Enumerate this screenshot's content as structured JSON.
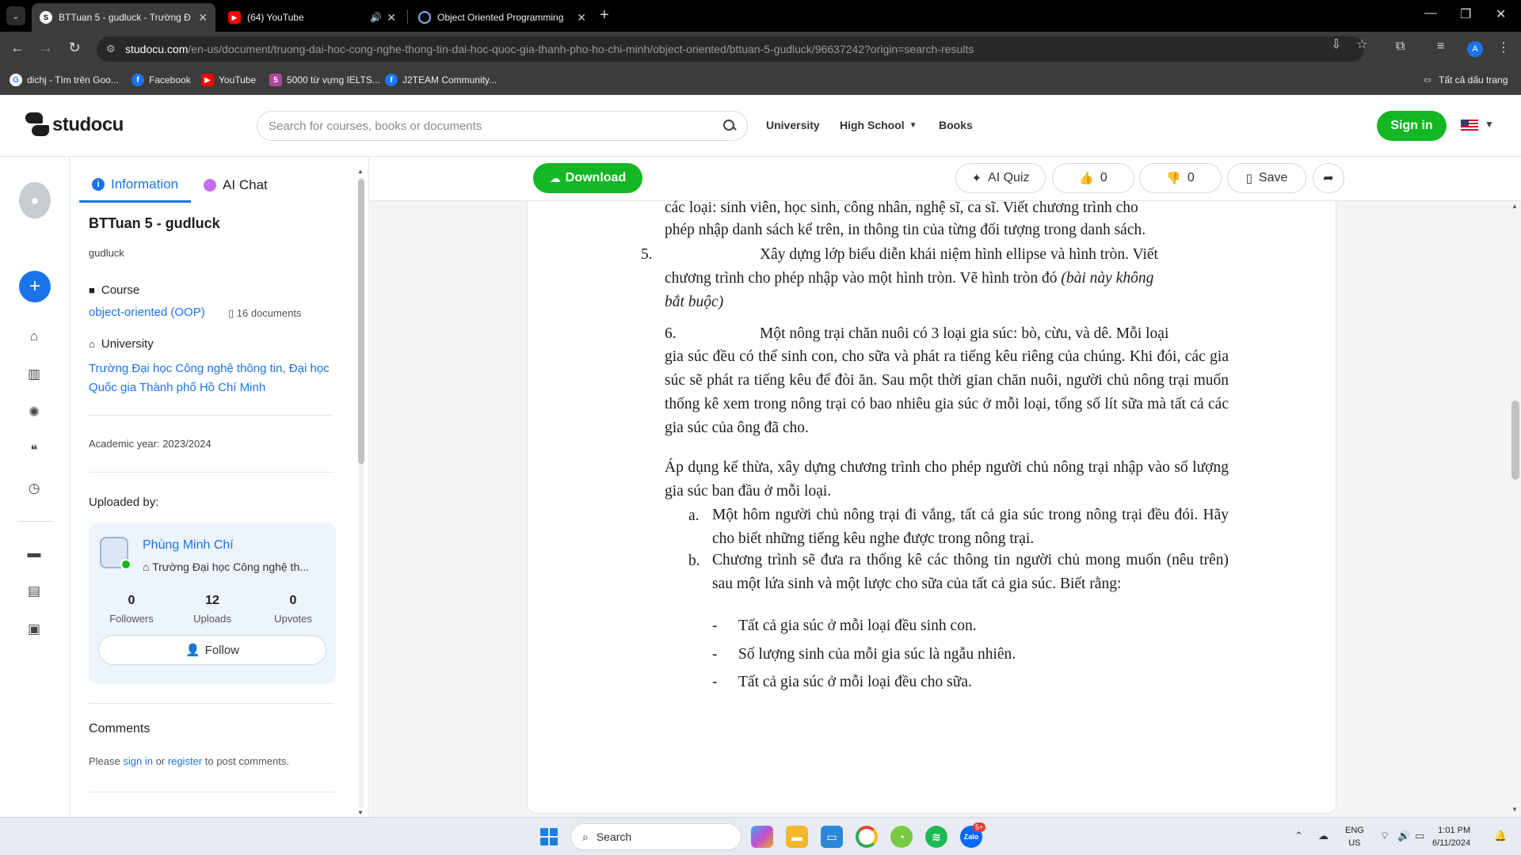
{
  "browser": {
    "tabs": [
      {
        "title": "BTTuan 5 - gudluck - Trường Đ",
        "active": true
      },
      {
        "title": "(64) YouTube",
        "active": false,
        "audio": true
      },
      {
        "title": "Object Oriented Programming",
        "active": false
      }
    ],
    "url_host": "studocu.com",
    "url_path": "/en-us/document/truong-dai-hoc-cong-nghe-thong-tin-dai-hoc-quoc-gia-thanh-pho-ho-chi-minh/object-oriented/bttuan-5-gudluck/96637242?origin=search-results",
    "profile_initial": "A",
    "bookmarks": [
      {
        "label": "dichj - Tìm trên Goo..."
      },
      {
        "label": "Facebook"
      },
      {
        "label": "YouTube"
      },
      {
        "label": "5000 từ vựng IELTS..."
      },
      {
        "label": "J2TEAM Community..."
      }
    ],
    "all_bookmarks": "Tất cả dấu trang"
  },
  "header": {
    "logo": "studocu",
    "search_placeholder": "Search for courses, books or documents",
    "nav": {
      "university": "University",
      "high_school": "High School",
      "books": "Books"
    },
    "signin": "Sign in"
  },
  "sidebar": {
    "tabs": {
      "information": "Information",
      "ai_chat": "AI Chat"
    },
    "doc_title": "BTTuan 5 - gudluck",
    "doc_author": "gudluck",
    "course_label": "Course",
    "course_name": "object-oriented (OOP)",
    "course_docs": "16 documents",
    "university_label": "University",
    "university_name": "Trường Đại học Công nghệ thông tin, Đại học Quốc gia Thành phố Hồ Chí Minh",
    "academic_year": "Academic year: 2023/2024",
    "uploaded_by": "Uploaded by:",
    "uploader": {
      "name": "Phùng Minh Chí",
      "university": "Trường Đại học Công nghệ th...",
      "followers": "0",
      "followers_label": "Followers",
      "uploads": "12",
      "uploads_label": "Uploads",
      "upvotes": "0",
      "upvotes_label": "Upvotes",
      "follow": "Follow"
    },
    "comments_title": "Comments",
    "comments_note": {
      "please": "Please",
      "sign_in": "sign in",
      "or": "or",
      "register": "register",
      "tail": "to post comments."
    }
  },
  "doc_toolbar": {
    "download": "Download",
    "ai_quiz": "AI Quiz",
    "likes": "0",
    "dislikes": "0",
    "save": "Save"
  },
  "document": {
    "intro_l1": "các loại: sinh viên, học sinh, công nhân, nghệ sĩ, ca sĩ. Viết chương trình cho",
    "intro_l2": "phép nhập danh sách kể trên, in thông tin của từng đối tượng trong danh sách.",
    "item5_num": "5.",
    "item5_l1": "Xây dựng lớp biểu diễn khái niệm hình ellipse và hình tròn. Viết",
    "item5_l2a": "chương trình cho phép nhập vào một hình tròn. Vẽ hình tròn đó",
    "item5_l2b": "(bài này không",
    "item5_l3": "bắt buộc)",
    "item6_num": "6.",
    "item6_l1": "Một nông trại chăn nuôi có 3 loại gia súc: bò, cừu, và dê. Mỗi loại",
    "item6_rest": "gia súc đều có thể sinh con, cho sữa và phát ra tiếng kêu riêng của chúng. Khi đói, các gia súc sẽ phát ra tiếng kêu để đòi ăn. Sau một thời gian chăn nuôi, người chủ nông trại muốn thống kê xem trong nông trại có bao nhiêu gia súc ở mỗi loại, tổng số lít sữa mà tất cả các gia súc của ông đã cho.",
    "apply": "Áp dụng kế thừa, xây dựng chương trình cho phép người chủ nông trại nhập vào số lượng gia súc ban đầu ở mỗi loại.",
    "a_label": "a.",
    "a_text": "Một hôm người chủ nông trại đi vắng, tất cả gia súc trong nông trại đều đói. Hãy cho biết những tiếng kêu nghe được trong nông trại.",
    "b_label": "b.",
    "b_text": "Chương trình sẽ đưa ra thống kê các thông tin người chủ mong muốn (nêu trên) sau một lứa sinh và một lược cho sữa của tất cả gia súc. Biết rằng:",
    "bullet1": "Tất cả gia súc ở mỗi loại đều sinh con.",
    "bullet2": "Số lượng sinh của mỗi gia súc là ngẫu nhiên.",
    "bullet3": "Tất cả gia súc ở mỗi loại đều cho sữa.",
    "dash": "-"
  },
  "taskbar": {
    "search": "Search",
    "lang1": "ENG",
    "lang2": "US",
    "time": "1:01 PM",
    "date": "6/11/2024",
    "zalo_badge": "5+"
  }
}
